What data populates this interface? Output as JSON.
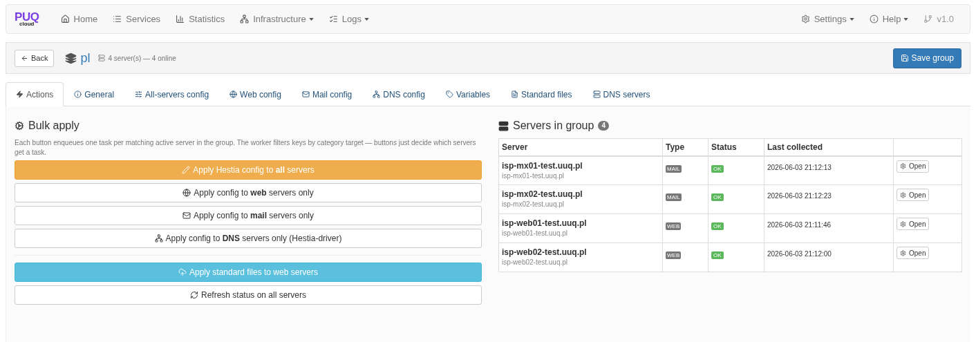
{
  "brand": {
    "logo": "PUQ",
    "sub": "cloud"
  },
  "nav_left": [
    {
      "label": "Home",
      "dropdown": false
    },
    {
      "label": "Services",
      "dropdown": false
    },
    {
      "label": "Statistics",
      "dropdown": false
    },
    {
      "label": "Infrastructure",
      "dropdown": true
    },
    {
      "label": "Logs",
      "dropdown": true
    }
  ],
  "nav_right": [
    {
      "label": "Settings",
      "dropdown": true
    },
    {
      "label": "Help",
      "dropdown": true
    },
    {
      "label": "v1.0",
      "dropdown": false
    }
  ],
  "header": {
    "back": "Back",
    "group": "pl",
    "summary": "4 server(s) — 4 online",
    "save": "Save group"
  },
  "tabs": [
    {
      "label": "Actions",
      "selected": true
    },
    {
      "label": "General",
      "selected": false
    },
    {
      "label": "All-servers config",
      "selected": false
    },
    {
      "label": "Web config",
      "selected": false
    },
    {
      "label": "Mail config",
      "selected": false
    },
    {
      "label": "DNS config",
      "selected": false
    },
    {
      "label": "Variables",
      "selected": false
    },
    {
      "label": "Standard files",
      "selected": false
    },
    {
      "label": "DNS servers",
      "selected": false
    }
  ],
  "bulk": {
    "title": "Bulk apply",
    "description": "Each button enqueues one task per matching active server in the group. The worker filters keys by category target — buttons just decide which servers get a task.",
    "button_groups": [
      [
        {
          "label": "Apply Hestia config to **all** servers",
          "kind": "warning"
        },
        {
          "label": "Apply config to **web** servers only",
          "kind": "default"
        },
        {
          "label": "Apply config to **mail** servers only",
          "kind": "default"
        },
        {
          "label": "Apply config to **DNS** servers only (Hestia-driver)",
          "kind": "default"
        }
      ],
      [
        {
          "label": "Apply standard files to web servers",
          "kind": "info"
        },
        {
          "label": "Refresh status on all servers",
          "kind": "default"
        }
      ]
    ]
  },
  "servers": {
    "title": "Servers in group",
    "count": "4",
    "columns": [
      "Server",
      "Type",
      "Status",
      "Last collected"
    ],
    "rows": [
      {
        "name": "isp-mx01-test.uuq.pl",
        "host": "isp-mx01-test.uuq.pl",
        "type": "MAIL",
        "status": "OK",
        "last_collected": "2026-06-03 21:12:13",
        "action": "Open"
      },
      {
        "name": "isp-mx02-test.uuq.pl",
        "host": "isp-mx02-test.uuq.pl",
        "type": "MAIL",
        "status": "OK",
        "last_collected": "2026-06-03 21:12:23",
        "action": "Open"
      },
      {
        "name": "isp-web01-test.uuq.pl",
        "host": "isp-web01-test.uuq.pl",
        "type": "WEB",
        "status": "OK",
        "last_collected": "2026-06-03 21:11:46",
        "action": "Open"
      },
      {
        "name": "isp-web02-test.uuq.pl",
        "host": "isp-web02-test.uuq.pl",
        "type": "WEB",
        "status": "OK",
        "last_collected": "2026-06-03 21:12:00",
        "action": "Open"
      }
    ]
  }
}
